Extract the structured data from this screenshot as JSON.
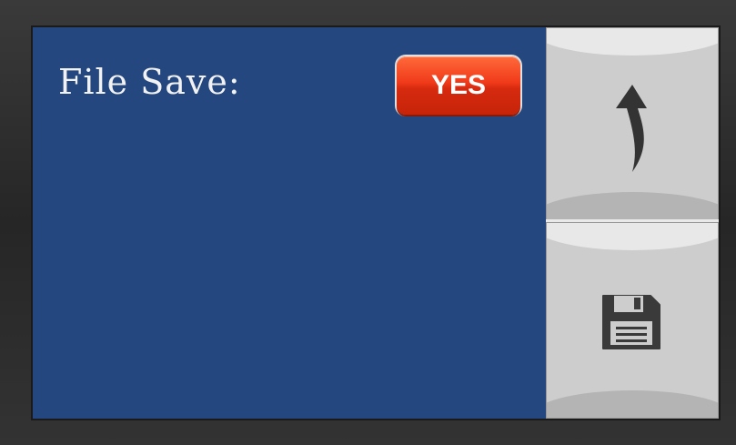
{
  "panel": {
    "label": "File Save:",
    "yes_button_label": "YES"
  },
  "side_buttons": {
    "back_icon": "back-arrow-icon",
    "save_icon": "floppy-disk-icon"
  },
  "colors": {
    "panel_bg": "#24477f",
    "yes_button": "#f03a1a",
    "side_button_bg": "#cdcdcd",
    "icon": "#3a3a3a"
  }
}
